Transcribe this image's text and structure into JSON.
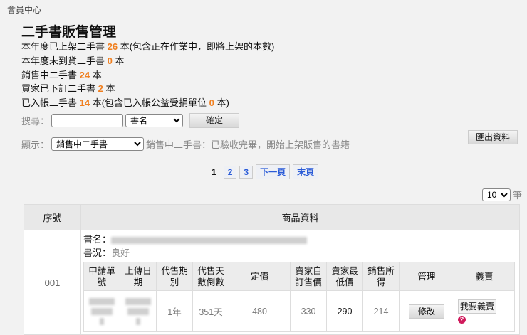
{
  "breadcrumb": "會員中心",
  "title": "二手書販售管理",
  "stats": [
    {
      "pre": "本年度已上架二手書 ",
      "num": "26",
      "post": " 本(包含正在作業中，即將上架的本數)"
    },
    {
      "pre": "本年度未到貨二手書 ",
      "num": "0",
      "post": " 本"
    },
    {
      "pre": "銷售中二手書 ",
      "num": "24",
      "post": " 本"
    },
    {
      "pre": "買家已下訂二手書 ",
      "num": "2",
      "post": " 本"
    },
    {
      "pre": "已入帳二手書 ",
      "num": "14",
      "post": " 本(包含已入帳公益受捐單位 ",
      "num2": "0",
      "post2": " 本)"
    }
  ],
  "search": {
    "label": "搜尋：",
    "value": "",
    "field": "書名",
    "confirm": "確定"
  },
  "display": {
    "label": "顯示：",
    "value": "銷售中二手書",
    "desc": "銷售中二手書：已驗收完畢，開始上架販售的書籍"
  },
  "export_label": "匯出資料",
  "pagination": {
    "current": "1",
    "pages": [
      "2",
      "3"
    ],
    "next": "下一頁",
    "last": "末頁"
  },
  "per_page": {
    "value": "10",
    "unit": "筆"
  },
  "table": {
    "headers": [
      "序號",
      "商品資料"
    ],
    "rows": [
      {
        "index": "001",
        "title_label": "書名：",
        "condition_label": "書況：",
        "condition": "良好",
        "sub_headers": [
          "申請單號",
          "上傳日期",
          "代售期別",
          "代售天數倒數",
          "定價",
          "賣家自訂售價",
          "賣家最低價",
          "銷售所得",
          "管理",
          "義賣"
        ],
        "period": "1年",
        "days_left": "351天",
        "list_price": "480",
        "seller_price": "330",
        "min_price": "290",
        "income": "214",
        "edit_label": "修改",
        "charity_label": "我要義賣"
      }
    ]
  }
}
